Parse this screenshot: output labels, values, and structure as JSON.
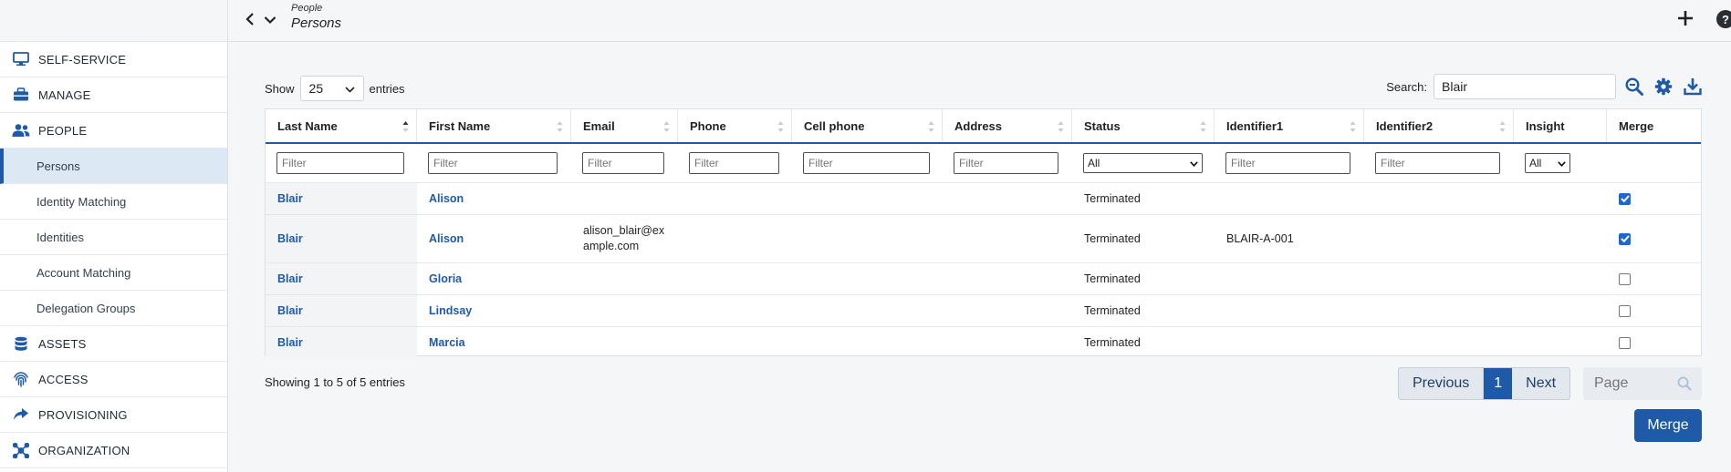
{
  "header": {
    "breadcrumb_parent": "People",
    "breadcrumb_current": "Persons",
    "help_label": "?"
  },
  "sidebar": {
    "items": [
      {
        "label": "SELF-SERVICE",
        "icon": "monitor-icon"
      },
      {
        "label": "MANAGE",
        "icon": "toolbox-icon"
      },
      {
        "label": "PEOPLE",
        "icon": "people-icon"
      },
      {
        "label": "ASSETS",
        "icon": "database-icon"
      },
      {
        "label": "ACCESS",
        "icon": "fingerprint-icon"
      },
      {
        "label": "PROVISIONING",
        "icon": "share-arrow-icon"
      },
      {
        "label": "ORGANIZATION",
        "icon": "hub-icon"
      }
    ],
    "people_sub": [
      {
        "label": "Persons",
        "active": true
      },
      {
        "label": "Identity Matching"
      },
      {
        "label": "Identities"
      },
      {
        "label": "Account Matching"
      },
      {
        "label": "Delegation Groups"
      }
    ]
  },
  "controls": {
    "show_label": "Show",
    "entries_value": "25",
    "entries_label": "entries",
    "search_label": "Search:",
    "search_value": "Blair"
  },
  "table": {
    "columns": [
      "Last Name",
      "First Name",
      "Email",
      "Phone",
      "Cell phone",
      "Address",
      "Status",
      "Identifier1",
      "Identifier2",
      "Insight",
      "Merge"
    ],
    "filter_placeholder": "Filter",
    "status_filter": "All",
    "insight_filter": "All",
    "rows": [
      {
        "last": "Blair",
        "first": "Alison",
        "email_1": "",
        "email_2": "",
        "status": "Terminated",
        "id1": "",
        "merge": true
      },
      {
        "last": "Blair",
        "first": "Alison",
        "email_1": "alison_blair@ex",
        "email_2": "ample.com",
        "status": "Terminated",
        "id1": "BLAIR-A-001",
        "merge": true
      },
      {
        "last": "Blair",
        "first": "Gloria",
        "email_1": "",
        "email_2": "",
        "status": "Terminated",
        "id1": "",
        "merge": false
      },
      {
        "last": "Blair",
        "first": "Lindsay",
        "email_1": "",
        "email_2": "",
        "status": "Terminated",
        "id1": "",
        "merge": false
      },
      {
        "last": "Blair",
        "first": "Marcia",
        "email_1": "",
        "email_2": "",
        "status": "Terminated",
        "id1": "",
        "merge": false
      }
    ]
  },
  "footer": {
    "info": "Showing 1 to 5 of 5 entries",
    "previous": "Previous",
    "page_current": "1",
    "next": "Next",
    "page_placeholder": "Page",
    "merge_button": "Merge"
  },
  "colors": {
    "accent": "#1e5aa8",
    "checkbox_checked": "#1e66d0"
  }
}
